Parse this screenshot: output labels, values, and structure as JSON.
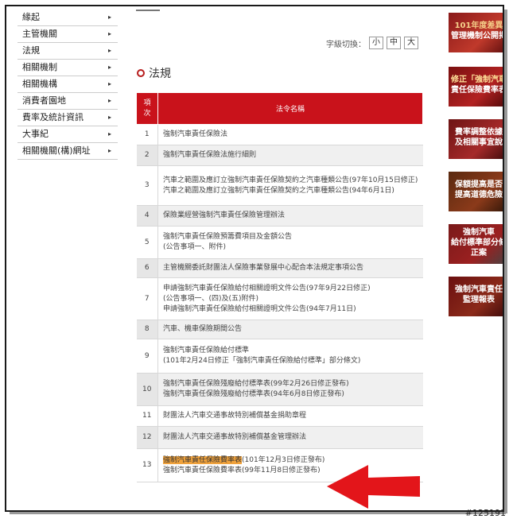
{
  "sidebar": {
    "items": [
      {
        "label": "緣起"
      },
      {
        "label": "主管機關"
      },
      {
        "label": "法規"
      },
      {
        "label": "相關機制"
      },
      {
        "label": "相關機構"
      },
      {
        "label": "消費者園地"
      },
      {
        "label": "費率及統計資訊"
      },
      {
        "label": "大事紀"
      },
      {
        "label": "相關機關(構)網址"
      }
    ],
    "chevron": "▸"
  },
  "font_switch": {
    "label": "字級切換：",
    "small": "小",
    "medium": "中",
    "large": "大"
  },
  "page": {
    "title": "法規"
  },
  "table": {
    "headers": {
      "num": "項\n次",
      "name": "法令名稱"
    },
    "rows": [
      {
        "num": "1",
        "lines": [
          "強制汽車責任保險法"
        ]
      },
      {
        "num": "2",
        "lines": [
          "強制汽車責任保險法施行細則"
        ]
      },
      {
        "num": "3",
        "lines": [
          "汽車之範圍及應訂立強制汽車責任保險契約之汽車種類公告(97年10月15日修正)",
          "汽車之範圍及應訂立強制汽車責任保險契約之汽車種類公告(94年6月1日)"
        ]
      },
      {
        "num": "4",
        "lines": [
          "保險業經營強制汽車責任保險管理辦法"
        ]
      },
      {
        "num": "5",
        "lines": [
          "強制汽車責任保險預籌費項目及金額公告",
          "(公告事項一、附件)"
        ]
      },
      {
        "num": "6",
        "lines": [
          "主管機關委託財團法人保險事業發展中心配合本法規定事項公告"
        ]
      },
      {
        "num": "7",
        "lines": [
          "申請強制汽車責任保險給付相關證明文件公告(97年9月22日修正)",
          "(公告事項一、(四)及(五)附件)",
          "申請強制汽車責任保險給付相關證明文件公告(94年7月11日)"
        ]
      },
      {
        "num": "8",
        "lines": [
          "汽車、機車保險期間公告"
        ]
      },
      {
        "num": "9",
        "lines": [
          "強制汽車責任保險給付標準",
          "(101年2月24日修正「強制汽車責任保險給付標準」部分條文)"
        ]
      },
      {
        "num": "10",
        "lines": [
          "強制汽車責任保險殘廢給付標準表(99年2月26日修正發布)",
          "強制汽車責任保險殘廢給付標準表(94年6月8日修正發布)"
        ]
      },
      {
        "num": "11",
        "lines": [
          "財團法人汽車交通事故特別補償基金捐助章程"
        ]
      },
      {
        "num": "12",
        "lines": [
          "財團法人汽車交通事故特別補償基金管理辦法"
        ]
      },
      {
        "num": "13",
        "highlight": "強制汽車責任保險費率表",
        "rest": "(101年12月3日修正發布)",
        "line2": "強制汽車責任保險費率表(99年11月8日修正發布)"
      }
    ]
  },
  "banners": [
    {
      "lines": [
        "101年度差異",
        "管理機制公開揭"
      ]
    },
    {
      "lines": [
        "修正「強制汽車",
        "責任保險費率表"
      ]
    },
    {
      "lines": [
        "費率調整依據",
        "及相關事宜說"
      ]
    },
    {
      "lines": [
        "保額提高是否",
        "提高道德危險"
      ]
    },
    {
      "lines": [
        "強制汽車",
        "給付標準部分條",
        "正案"
      ]
    },
    {
      "lines": [
        "強制汽車責任",
        "監理報表"
      ]
    }
  ],
  "watermark": "#125191",
  "colors": {
    "accent": "#c9121b",
    "highlight": "#f0a23c",
    "arrow": "#e3151a"
  }
}
